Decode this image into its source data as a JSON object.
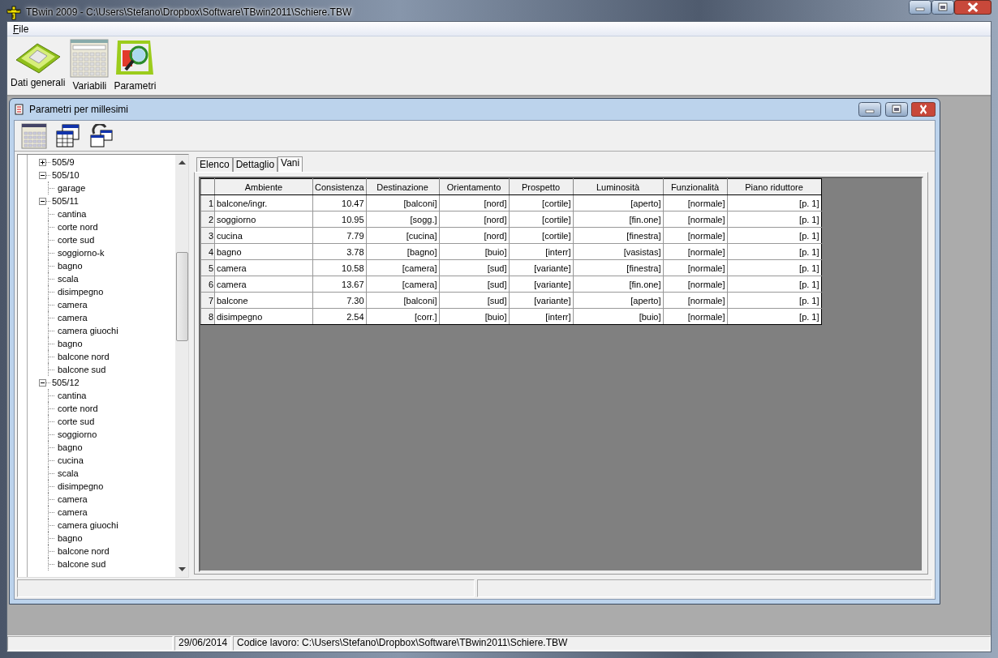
{
  "window": {
    "title": "TBwin 2009 - C:\\Users\\Stefano\\Dropbox\\Software\\TBwin2011\\Schiere.TBW"
  },
  "menu": [
    {
      "label": "File"
    }
  ],
  "toolbar": [
    {
      "label": "Dati generali"
    },
    {
      "label": "Variabili"
    },
    {
      "label": "Parametri"
    }
  ],
  "child_window": {
    "title": "Parametri per millesimi",
    "tree": [
      {
        "label": "505/9",
        "expanded": false
      },
      {
        "label": "505/10",
        "expanded": true,
        "children": [
          {
            "label": "garage"
          }
        ]
      },
      {
        "label": "505/11",
        "expanded": true,
        "children": [
          {
            "label": "cantina"
          },
          {
            "label": "corte nord"
          },
          {
            "label": "corte sud"
          },
          {
            "label": "soggiorno-k"
          },
          {
            "label": "bagno"
          },
          {
            "label": "scala"
          },
          {
            "label": "disimpegno"
          },
          {
            "label": "camera"
          },
          {
            "label": "camera"
          },
          {
            "label": "camera giuochi"
          },
          {
            "label": "bagno"
          },
          {
            "label": "balcone nord"
          },
          {
            "label": "balcone sud"
          }
        ]
      },
      {
        "label": "505/12",
        "expanded": true,
        "children": [
          {
            "label": "cantina"
          },
          {
            "label": "corte nord"
          },
          {
            "label": "corte sud"
          },
          {
            "label": "soggiorno"
          },
          {
            "label": "bagno"
          },
          {
            "label": "cucina"
          },
          {
            "label": "scala"
          },
          {
            "label": "disimpegno"
          },
          {
            "label": "camera"
          },
          {
            "label": "camera"
          },
          {
            "label": "camera giuochi"
          },
          {
            "label": "bagno"
          },
          {
            "label": "balcone nord"
          },
          {
            "label": "balcone sud"
          }
        ]
      }
    ],
    "tabs": [
      {
        "label": "Elenco",
        "selected": false
      },
      {
        "label": "Dettaglio",
        "selected": false
      },
      {
        "label": "Vani",
        "selected": true
      }
    ],
    "table": {
      "columns": [
        "Ambiente",
        "Consistenza",
        "Destinazione",
        "Orientamento",
        "Prospetto",
        "Luminosità",
        "Funzionalità",
        "Piano riduttore"
      ],
      "rows": [
        {
          "number": "1",
          "cells": [
            "balcone/ingr.",
            "10.47",
            "[balconi]",
            "[nord]",
            "[cortile]",
            "[aperto]",
            "[normale]",
            "[p. 1]"
          ]
        },
        {
          "number": "2",
          "cells": [
            "soggiorno",
            "10.95",
            "[sogg.]",
            "[nord]",
            "[cortile]",
            "[fin.one]",
            "[normale]",
            "[p. 1]"
          ]
        },
        {
          "number": "3",
          "cells": [
            "cucina",
            "7.79",
            "[cucina]",
            "[nord]",
            "[cortile]",
            "[finestra]",
            "[normale]",
            "[p. 1]"
          ]
        },
        {
          "number": "4",
          "cells": [
            "bagno",
            "3.78",
            "[bagno]",
            "[buio]",
            "[interr]",
            "[vasistas]",
            "[normale]",
            "[p. 1]"
          ]
        },
        {
          "number": "5",
          "cells": [
            "camera",
            "10.58",
            "[camera]",
            "[sud]",
            "[variante]",
            "[finestra]",
            "[normale]",
            "[p. 1]"
          ]
        },
        {
          "number": "6",
          "cells": [
            "camera",
            "13.67",
            "[camera]",
            "[sud]",
            "[variante]",
            "[fin.one]",
            "[normale]",
            "[p. 1]"
          ]
        },
        {
          "number": "7",
          "cells": [
            "balcone",
            "7.30",
            "[balconi]",
            "[sud]",
            "[variante]",
            "[aperto]",
            "[normale]",
            "[p. 1]"
          ]
        },
        {
          "number": "8",
          "cells": [
            "disimpegno",
            "2.54",
            "[corr.]",
            "[buio]",
            "[interr]",
            "[buio]",
            "[normale]",
            "[p. 1]"
          ]
        }
      ]
    }
  },
  "status_bar": [
    "29/06/2014",
    "Codice lavoro: C:\\Users\\Stefano\\Dropbox\\Software\\TBwin2011\\Schiere.TBW"
  ]
}
